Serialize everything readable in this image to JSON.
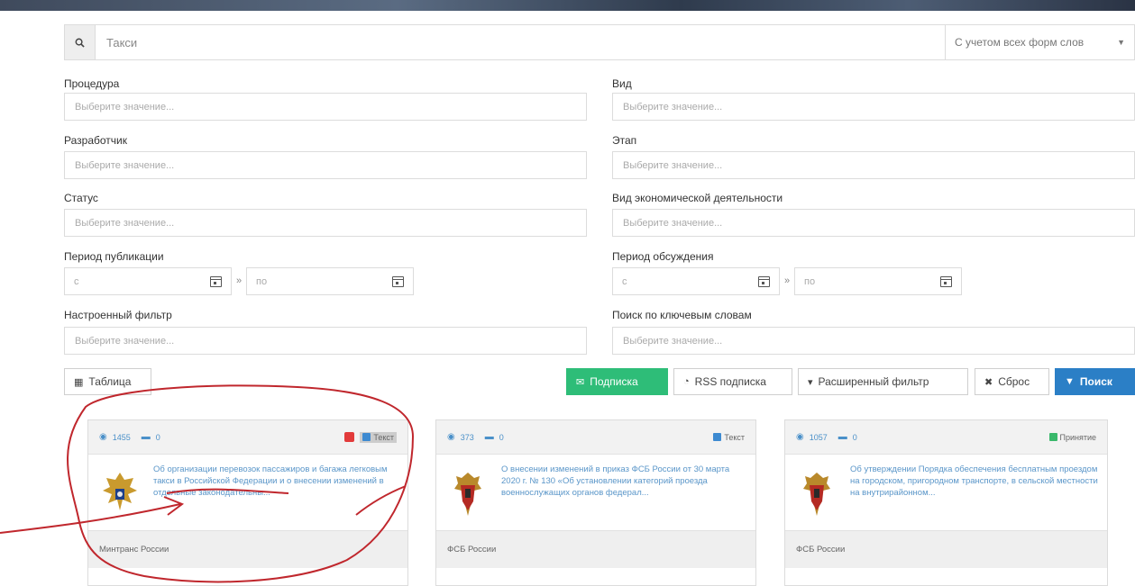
{
  "search": {
    "value": "Такси",
    "word_form_option": "С учетом всех форм слов"
  },
  "filters": {
    "placeholder": "Выберите значение...",
    "procedure_label": "Процедура",
    "type_label": "Вид",
    "developer_label": "Разработчик",
    "stage_label": "Этап",
    "status_label": "Статус",
    "economic_activity_label": "Вид экономической деятельности",
    "publication_period_label": "Период публикации",
    "discussion_period_label": "Период обсуждения",
    "date_from": "с",
    "date_to": "по",
    "range_separator": "»",
    "custom_filter_label": "Настроенный фильтр",
    "keyword_search_label": "Поиск по ключевым словам"
  },
  "toolbar": {
    "table_label": "Таблица",
    "subscribe_label": "Подписка",
    "rss_label": "RSS подписка",
    "advanced_filter_label": "Расширенный фильтр",
    "reset_label": "Сброс",
    "search_label": "Поиск"
  },
  "cards": [
    {
      "views": "1455",
      "comments": "0",
      "tag": "Текст",
      "title": "Об организации перевозок пассажиров и багажа легковым такси в Российской Федерации и о внесении изменений в отдельные законодательны...",
      "agency": "Минтранс России",
      "emblem": "eagle-emblem"
    },
    {
      "views": "373",
      "comments": "0",
      "tag": "Текст",
      "title": "О внесении изменений в приказ ФСБ России от 30 марта 2020 г. № 130 «Об установлении категорий проезда военнослужащих органов федерал...",
      "agency": "ФСБ России",
      "emblem": "fsb-emblem"
    },
    {
      "views": "1057",
      "comments": "0",
      "tag": "Принятие",
      "title": "Об утверждении Порядка обеспечения бесплатным проездом на городском, пригородном транспорте, в сельской местности на внутрирайонном...",
      "agency": "ФСБ России",
      "emblem": "fsb-emblem"
    }
  ],
  "colors": {
    "accent_blue": "#2b7fc6",
    "subscribe_green": "#2ebd78",
    "annotation_red": "#c0272d"
  }
}
